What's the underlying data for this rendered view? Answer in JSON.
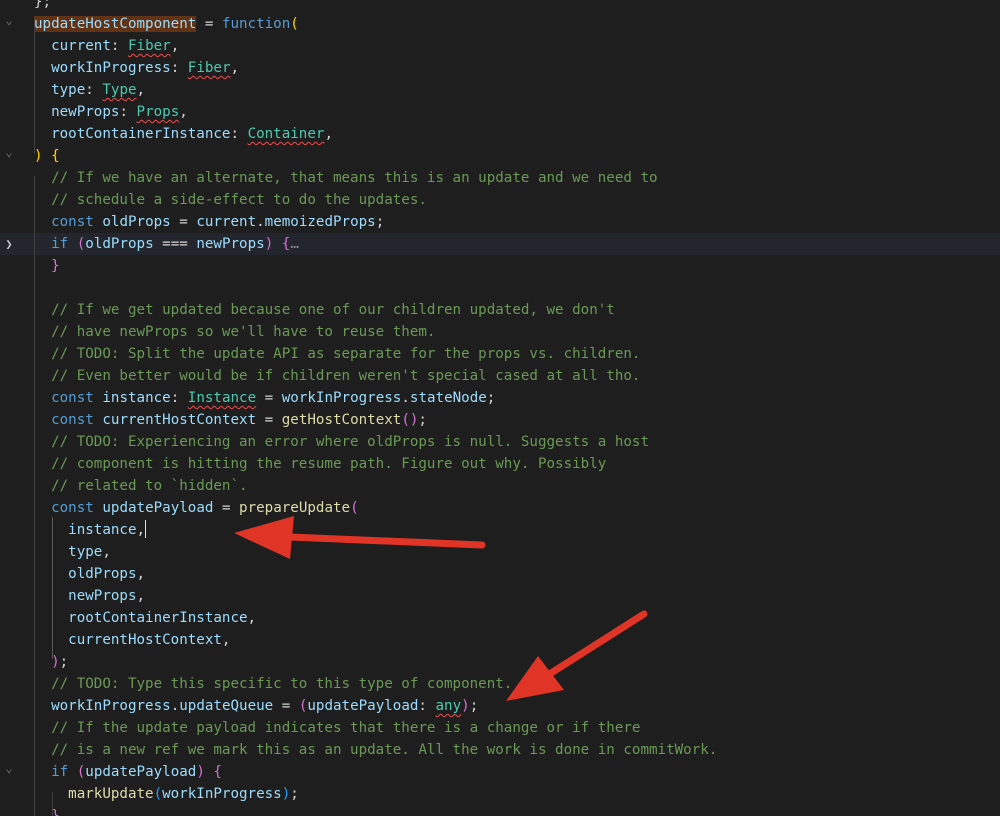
{
  "editor": {
    "language": "javascript",
    "colors": {
      "background": "#1e1e1e",
      "arrow": "#e03526",
      "error_squiggle": "#f14c4c"
    },
    "lines": [
      {
        "fold": "none",
        "tokens": [
          [
            "punc",
            "};"
          ]
        ]
      },
      {
        "fold": "open",
        "tokens": [
          [
            "sel",
            "updateHostComponent"
          ],
          [
            "punc",
            " = "
          ],
          [
            "kw",
            "function"
          ],
          [
            "br1",
            "("
          ]
        ]
      },
      {
        "fold": "none",
        "tokens": [
          [
            "punc",
            "  "
          ],
          [
            "var",
            "current"
          ],
          [
            "punc",
            ": "
          ],
          [
            "type-e",
            "Fiber"
          ],
          [
            "punc",
            ","
          ]
        ]
      },
      {
        "fold": "none",
        "tokens": [
          [
            "punc",
            "  "
          ],
          [
            "var",
            "workInProgress"
          ],
          [
            "punc",
            ": "
          ],
          [
            "type-e",
            "Fiber"
          ],
          [
            "punc",
            ","
          ]
        ]
      },
      {
        "fold": "none",
        "tokens": [
          [
            "punc",
            "  "
          ],
          [
            "var",
            "type"
          ],
          [
            "punc",
            ": "
          ],
          [
            "type-e",
            "Type"
          ],
          [
            "punc",
            ","
          ]
        ]
      },
      {
        "fold": "none",
        "tokens": [
          [
            "punc",
            "  "
          ],
          [
            "var",
            "newProps"
          ],
          [
            "punc",
            ": "
          ],
          [
            "type-e",
            "Props"
          ],
          [
            "punc",
            ","
          ]
        ]
      },
      {
        "fold": "none",
        "tokens": [
          [
            "punc",
            "  "
          ],
          [
            "var",
            "rootContainerInstance"
          ],
          [
            "punc",
            ": "
          ],
          [
            "type-e",
            "Container"
          ],
          [
            "punc",
            ","
          ]
        ]
      },
      {
        "fold": "open",
        "tokens": [
          [
            "br1",
            ")"
          ],
          [
            "punc",
            " "
          ],
          [
            "br1",
            "{"
          ]
        ]
      },
      {
        "fold": "none",
        "tokens": [
          [
            "punc",
            "  "
          ],
          [
            "com",
            "// If we have an alternate, that means this is an update and we need to"
          ]
        ]
      },
      {
        "fold": "none",
        "tokens": [
          [
            "punc",
            "  "
          ],
          [
            "com",
            "// schedule a side-effect to do the updates."
          ]
        ]
      },
      {
        "fold": "none",
        "tokens": [
          [
            "punc",
            "  "
          ],
          [
            "kw",
            "const"
          ],
          [
            "punc",
            " "
          ],
          [
            "var",
            "oldProps"
          ],
          [
            "punc",
            " = "
          ],
          [
            "var",
            "current"
          ],
          [
            "punc",
            "."
          ],
          [
            "var",
            "memoizedProps"
          ],
          [
            "punc",
            ";"
          ]
        ]
      },
      {
        "fold": "closed",
        "highlight": true,
        "tokens": [
          [
            "punc",
            "  "
          ],
          [
            "kw",
            "if"
          ],
          [
            "punc",
            " "
          ],
          [
            "br2",
            "("
          ],
          [
            "var",
            "oldProps"
          ],
          [
            "punc",
            " === "
          ],
          [
            "var",
            "newProps"
          ],
          [
            "br2",
            ")"
          ],
          [
            "punc",
            " "
          ],
          [
            "br2",
            "{"
          ],
          [
            "fold",
            "…"
          ]
        ]
      },
      {
        "fold": "none",
        "tokens": [
          [
            "punc",
            "  "
          ],
          [
            "br2",
            "}"
          ]
        ]
      },
      {
        "fold": "none",
        "tokens": []
      },
      {
        "fold": "none",
        "tokens": [
          [
            "punc",
            "  "
          ],
          [
            "com",
            "// If we get updated because one of our children updated, we don't"
          ]
        ]
      },
      {
        "fold": "none",
        "tokens": [
          [
            "punc",
            "  "
          ],
          [
            "com",
            "// have newProps so we'll have to reuse them."
          ]
        ]
      },
      {
        "fold": "none",
        "tokens": [
          [
            "punc",
            "  "
          ],
          [
            "com",
            "// TODO: Split the update API as separate for the props vs. children."
          ]
        ]
      },
      {
        "fold": "none",
        "tokens": [
          [
            "punc",
            "  "
          ],
          [
            "com",
            "// Even better would be if children weren't special cased at all tho."
          ]
        ]
      },
      {
        "fold": "none",
        "tokens": [
          [
            "punc",
            "  "
          ],
          [
            "kw",
            "const"
          ],
          [
            "punc",
            " "
          ],
          [
            "var",
            "instance"
          ],
          [
            "punc",
            ": "
          ],
          [
            "type-e",
            "Instance"
          ],
          [
            "punc",
            " = "
          ],
          [
            "var",
            "workInProgress"
          ],
          [
            "punc",
            "."
          ],
          [
            "var",
            "stateNode"
          ],
          [
            "punc",
            ";"
          ]
        ]
      },
      {
        "fold": "none",
        "tokens": [
          [
            "punc",
            "  "
          ],
          [
            "kw",
            "const"
          ],
          [
            "punc",
            " "
          ],
          [
            "var",
            "currentHostContext"
          ],
          [
            "punc",
            " = "
          ],
          [
            "fn",
            "getHostContext"
          ],
          [
            "br2",
            "()"
          ],
          [
            "punc",
            ";"
          ]
        ]
      },
      {
        "fold": "none",
        "tokens": [
          [
            "punc",
            "  "
          ],
          [
            "com",
            "// TODO: Experiencing an error where oldProps is null. Suggests a host"
          ]
        ]
      },
      {
        "fold": "none",
        "tokens": [
          [
            "punc",
            "  "
          ],
          [
            "com",
            "// component is hitting the resume path. Figure out why. Possibly"
          ]
        ]
      },
      {
        "fold": "none",
        "tokens": [
          [
            "punc",
            "  "
          ],
          [
            "com",
            "// related to `hidden`."
          ]
        ]
      },
      {
        "fold": "none",
        "tokens": [
          [
            "punc",
            "  "
          ],
          [
            "kw",
            "const"
          ],
          [
            "punc",
            " "
          ],
          [
            "var",
            "updatePayload"
          ],
          [
            "punc",
            " = "
          ],
          [
            "fn",
            "prepareUpdate"
          ],
          [
            "br2",
            "("
          ]
        ]
      },
      {
        "fold": "none",
        "tokens": [
          [
            "punc",
            "    "
          ],
          [
            "var",
            "instance"
          ],
          [
            "punc",
            ","
          ],
          [
            "cursor",
            ""
          ]
        ]
      },
      {
        "fold": "none",
        "tokens": [
          [
            "punc",
            "    "
          ],
          [
            "var",
            "type"
          ],
          [
            "punc",
            ","
          ]
        ]
      },
      {
        "fold": "none",
        "tokens": [
          [
            "punc",
            "    "
          ],
          [
            "var",
            "oldProps"
          ],
          [
            "punc",
            ","
          ]
        ]
      },
      {
        "fold": "none",
        "tokens": [
          [
            "punc",
            "    "
          ],
          [
            "var",
            "newProps"
          ],
          [
            "punc",
            ","
          ]
        ]
      },
      {
        "fold": "none",
        "tokens": [
          [
            "punc",
            "    "
          ],
          [
            "var",
            "rootContainerInstance"
          ],
          [
            "punc",
            ","
          ]
        ]
      },
      {
        "fold": "none",
        "tokens": [
          [
            "punc",
            "    "
          ],
          [
            "var",
            "currentHostContext"
          ],
          [
            "punc",
            ","
          ]
        ]
      },
      {
        "fold": "none",
        "tokens": [
          [
            "punc",
            "  "
          ],
          [
            "br2",
            ")"
          ],
          [
            "punc",
            ";"
          ]
        ]
      },
      {
        "fold": "none",
        "tokens": [
          [
            "punc",
            "  "
          ],
          [
            "com",
            "// TODO: Type this specific to this type of component."
          ]
        ]
      },
      {
        "fold": "none",
        "tokens": [
          [
            "punc",
            "  "
          ],
          [
            "var",
            "workInProgress"
          ],
          [
            "punc",
            "."
          ],
          [
            "var",
            "updateQueue"
          ],
          [
            "punc",
            " = "
          ],
          [
            "br2",
            "("
          ],
          [
            "var",
            "updatePayload"
          ],
          [
            "punc",
            ": "
          ],
          [
            "type-e",
            "any"
          ],
          [
            "br2",
            ")"
          ],
          [
            "punc",
            ";"
          ]
        ]
      },
      {
        "fold": "none",
        "tokens": [
          [
            "punc",
            "  "
          ],
          [
            "com",
            "// If the update payload indicates that there is a change or if there"
          ]
        ]
      },
      {
        "fold": "none",
        "tokens": [
          [
            "punc",
            "  "
          ],
          [
            "com",
            "// is a new ref we mark this as an update. All the work is done in commitWork."
          ]
        ]
      },
      {
        "fold": "open",
        "tokens": [
          [
            "punc",
            "  "
          ],
          [
            "kw",
            "if"
          ],
          [
            "punc",
            " "
          ],
          [
            "br2",
            "("
          ],
          [
            "var",
            "updatePayload"
          ],
          [
            "br2",
            ")"
          ],
          [
            "punc",
            " "
          ],
          [
            "br2",
            "{"
          ]
        ]
      },
      {
        "fold": "none",
        "tokens": [
          [
            "punc",
            "    "
          ],
          [
            "fn",
            "markUpdate"
          ],
          [
            "br3",
            "("
          ],
          [
            "var",
            "workInProgress"
          ],
          [
            "br3",
            ")"
          ],
          [
            "punc",
            ";"
          ]
        ]
      },
      {
        "fold": "none",
        "tokens": [
          [
            "punc",
            "  "
          ],
          [
            "br2",
            "}"
          ]
        ]
      }
    ]
  }
}
